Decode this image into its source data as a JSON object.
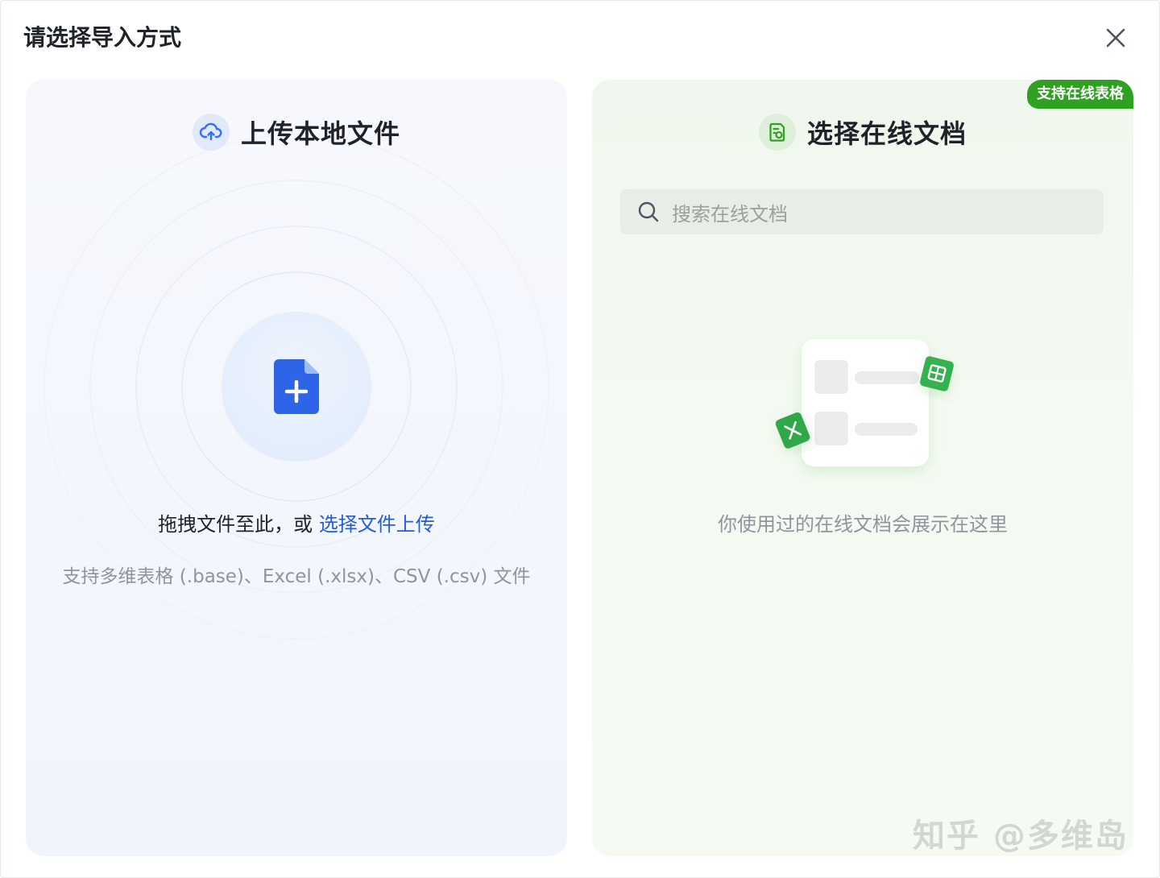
{
  "dialog": {
    "title": "请选择导入方式",
    "close_icon": "close-icon"
  },
  "local_upload": {
    "heading": "上传本地文件",
    "heading_icon": "cloud-upload-icon",
    "center_icon": "file-add-icon",
    "drag_text": "拖拽文件至此，或 ",
    "select_link": "选择文件上传",
    "support_text": "支持多维表格 (.base)、Excel (.xlsx)、CSV (.csv) 文件",
    "accent_color": "#245bdb"
  },
  "online_docs": {
    "badge": "支持在线表格",
    "heading": "选择在线文档",
    "heading_icon": "document-icon",
    "search_placeholder": "搜索在线文档",
    "search_icon": "search-icon",
    "empty_text": "你使用过的在线文档会展示在这里",
    "accent_color": "#2ea121"
  },
  "watermark": "知乎 @多维岛"
}
